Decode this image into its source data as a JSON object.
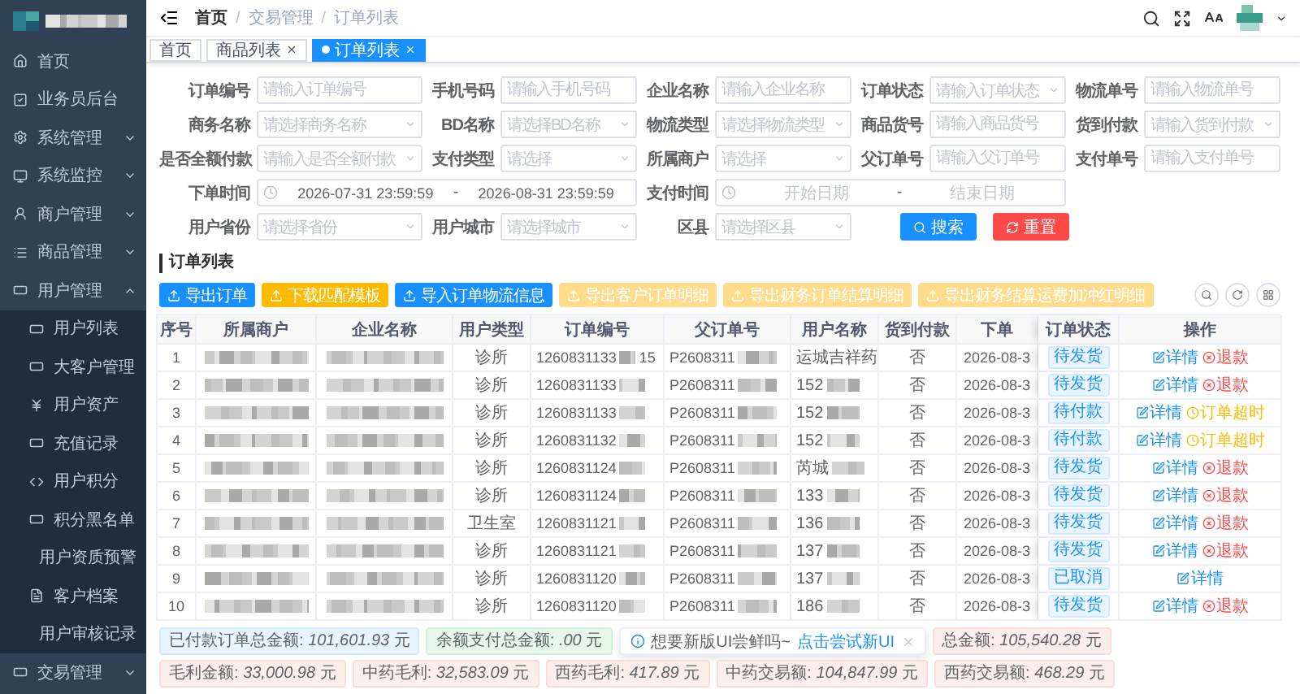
{
  "sidebar": {
    "items": [
      {
        "label": "首页"
      },
      {
        "label": "业务员后台"
      },
      {
        "label": "系统管理",
        "expanded": false
      },
      {
        "label": "系统监控",
        "expanded": false
      },
      {
        "label": "商户管理",
        "expanded": false
      },
      {
        "label": "商品管理",
        "expanded": false
      },
      {
        "label": "用户管理",
        "expanded": true,
        "children": [
          {
            "label": "用户列表"
          },
          {
            "label": "大客户管理"
          },
          {
            "label": "用户资产"
          },
          {
            "label": "充值记录"
          },
          {
            "label": "用户积分"
          },
          {
            "label": "积分黑名单"
          },
          {
            "label": "用户资质预警"
          },
          {
            "label": "客户档案"
          },
          {
            "label": "用户审核记录"
          }
        ]
      },
      {
        "label": "交易管理",
        "expanded": false
      }
    ]
  },
  "breadcrumb": {
    "separator": "/",
    "items": [
      {
        "label": "首页",
        "clickable": true
      },
      {
        "label": "交易管理",
        "clickable": false
      },
      {
        "label": "订单列表",
        "clickable": false
      }
    ]
  },
  "tabs": [
    {
      "label": "首页",
      "selected": false,
      "closable": false
    },
    {
      "label": "商品列表",
      "selected": false,
      "closable": true
    },
    {
      "label": "订单列表",
      "selected": true,
      "closable": true
    }
  ],
  "filter_rows": [
    [
      {
        "label": "订单编号",
        "kind": "input",
        "placeholder": "请输入订单编号"
      },
      {
        "label": "手机号码",
        "kind": "input",
        "placeholder": "请输入手机号码"
      },
      {
        "label": "企业名称",
        "kind": "input",
        "placeholder": "请输入企业名称"
      },
      {
        "label": "订单状态",
        "kind": "select",
        "placeholder": "请输入订单状态"
      },
      {
        "label": "物流单号",
        "kind": "input",
        "placeholder": "请输入物流单号"
      }
    ],
    [
      {
        "label": "商务名称",
        "kind": "select",
        "placeholder": "请选择商务名称"
      },
      {
        "label": "BD名称",
        "kind": "select",
        "placeholder": "请选择BD名称"
      },
      {
        "label": "物流类型",
        "kind": "select",
        "placeholder": "请选择物流类型"
      },
      {
        "label": "商品货号",
        "kind": "input",
        "placeholder": "请输入商品货号"
      },
      {
        "label": "货到付款",
        "kind": "select",
        "placeholder": "请输入货到付款"
      }
    ],
    [
      {
        "label": "是否全额付款",
        "kind": "select",
        "placeholder": "请输入是否全额付款"
      },
      {
        "label": "支付类型",
        "kind": "select",
        "placeholder": "请选择"
      },
      {
        "label": "所属商户",
        "kind": "select",
        "placeholder": "请选择"
      },
      {
        "label": "父订单号",
        "kind": "input",
        "placeholder": "请输入父订单号"
      },
      {
        "label": "支付单号",
        "kind": "input",
        "placeholder": "请输入支付单号"
      }
    ],
    [
      {
        "label": "下单时间",
        "kind": "daterange",
        "start": "2026-07-31 23:59:59",
        "end": "2026-08-31 23:59:59",
        "separator": "-"
      },
      {
        "label": "支付时间",
        "kind": "daterange",
        "start_placeholder": "开始日期",
        "end_placeholder": "结束日期",
        "separator": "-"
      }
    ],
    [
      {
        "label": "用户省份",
        "kind": "select",
        "placeholder": "请选择省份"
      },
      {
        "label": "用户城市",
        "kind": "select",
        "placeholder": "请选择城市"
      },
      {
        "label": "区县",
        "kind": "select",
        "placeholder": "请选择区县"
      }
    ]
  ],
  "filter_buttons": [
    {
      "kind": "search",
      "label": "搜索"
    },
    {
      "kind": "reset",
      "label": "重置"
    }
  ],
  "section_title": "订单列表",
  "toolbar": [
    {
      "label": "导出订单",
      "kind": "primary",
      "disabled": false
    },
    {
      "label": "下载匹配模板",
      "kind": "warning",
      "disabled": false
    },
    {
      "label": "导入订单物流信息",
      "kind": "primary",
      "disabled": false
    },
    {
      "label": "导出客户订单明细",
      "kind": "warning",
      "disabled": true
    },
    {
      "label": "导出财务订单结算明细",
      "kind": "warning",
      "disabled": true
    },
    {
      "label": "导出财务结算运费加冲红明细",
      "kind": "warning",
      "disabled": true
    }
  ],
  "table": {
    "columns": [
      "序号",
      "所属商户",
      "企业名称",
      "用户类型",
      "订单编号",
      "父订单号",
      "用户名称",
      "货到付款",
      "下单",
      "订单状态",
      "操作"
    ],
    "rows": [
      {
        "index": "1",
        "user_type": "诊所",
        "order_no": "1260831133",
        "order_tail": "15",
        "parent_no": "P2608311",
        "user_name": "运城吉祥药",
        "cod": "否",
        "order_time": "2026-08-3",
        "status": "待发货",
        "actions": [
          {
            "kind": "detail",
            "label": "详情"
          },
          {
            "kind": "refund",
            "label": "退款"
          }
        ]
      },
      {
        "index": "2",
        "user_type": "诊所",
        "order_no": "1260831133",
        "parent_no": "P2608311",
        "user_name": "152",
        "cod": "否",
        "order_time": "2026-08-3",
        "status": "待发货",
        "actions": [
          {
            "kind": "detail",
            "label": "详情"
          },
          {
            "kind": "refund",
            "label": "退款"
          }
        ]
      },
      {
        "index": "3",
        "user_type": "诊所",
        "order_no": "1260831133",
        "parent_no": "P2608311",
        "user_name": "152",
        "cod": "否",
        "order_time": "2026-08-3",
        "status": "待付款",
        "actions": [
          {
            "kind": "detail",
            "label": "详情"
          },
          {
            "kind": "timeout",
            "label": "订单超时"
          }
        ]
      },
      {
        "index": "4",
        "user_type": "诊所",
        "order_no": "1260831132",
        "parent_no": "P2608311",
        "user_name": "152",
        "cod": "否",
        "order_time": "2026-08-3",
        "status": "待付款",
        "actions": [
          {
            "kind": "detail",
            "label": "详情"
          },
          {
            "kind": "timeout",
            "label": "订单超时"
          }
        ]
      },
      {
        "index": "5",
        "user_type": "诊所",
        "order_no": "1260831124",
        "parent_no": "P2608311",
        "user_name": "芮城",
        "cod": "否",
        "order_time": "2026-08-3",
        "status": "待发货",
        "actions": [
          {
            "kind": "detail",
            "label": "详情"
          },
          {
            "kind": "refund",
            "label": "退款"
          }
        ]
      },
      {
        "index": "6",
        "user_type": "诊所",
        "order_no": "1260831124",
        "parent_no": "P2608311",
        "user_name": "133",
        "cod": "否",
        "order_time": "2026-08-3",
        "status": "待发货",
        "actions": [
          {
            "kind": "detail",
            "label": "详情"
          },
          {
            "kind": "refund",
            "label": "退款"
          }
        ]
      },
      {
        "index": "7",
        "user_type": "卫生室",
        "order_no": "1260831121",
        "parent_no": "P2608311",
        "user_name": "136",
        "cod": "否",
        "order_time": "2026-08-3",
        "status": "待发货",
        "actions": [
          {
            "kind": "detail",
            "label": "详情"
          },
          {
            "kind": "refund",
            "label": "退款"
          }
        ]
      },
      {
        "index": "8",
        "user_type": "诊所",
        "order_no": "1260831121",
        "parent_no": "P2608311",
        "user_name": "137",
        "cod": "否",
        "order_time": "2026-08-3",
        "status": "待发货",
        "actions": [
          {
            "kind": "detail",
            "label": "详情"
          },
          {
            "kind": "refund",
            "label": "退款"
          }
        ]
      },
      {
        "index": "9",
        "user_type": "诊所",
        "order_no": "1260831120",
        "parent_no": "P2608311",
        "user_name": "137",
        "cod": "否",
        "order_time": "2026-08-3",
        "status": "已取消",
        "actions": [
          {
            "kind": "detail",
            "label": "详情"
          }
        ]
      },
      {
        "index": "10",
        "user_type": "诊所",
        "order_no": "1260831120",
        "parent_no": "P2608311",
        "user_name": "186",
        "cod": "否",
        "order_time": "2026-08-3",
        "status": "待发货",
        "actions": [
          {
            "kind": "detail",
            "label": "详情"
          },
          {
            "kind": "refund",
            "label": "退款"
          }
        ]
      }
    ]
  },
  "summary": [
    {
      "kind": "info",
      "text": "已付款订单总金额: *101,601.93* 元"
    },
    {
      "kind": "success",
      "text": "余额支付总金额: *.00* 元"
    },
    {
      "kind": "toast",
      "text": "想要新版UI尝鲜吗~",
      "link": "点击尝试新UI"
    },
    {
      "kind": "danger",
      "text": "总金额: *105,540.28* 元"
    },
    {
      "kind": "danger",
      "text": "毛利金额: *33,000.98* 元"
    },
    {
      "kind": "danger",
      "text": "中药毛利: *32,583.09* 元"
    },
    {
      "kind": "danger",
      "text": "西药毛利: *417.89* 元"
    },
    {
      "kind": "danger",
      "text": "中药交易额: *104,847.99* 元"
    },
    {
      "kind": "danger",
      "text": "西药交易额: *468.29* 元"
    }
  ]
}
